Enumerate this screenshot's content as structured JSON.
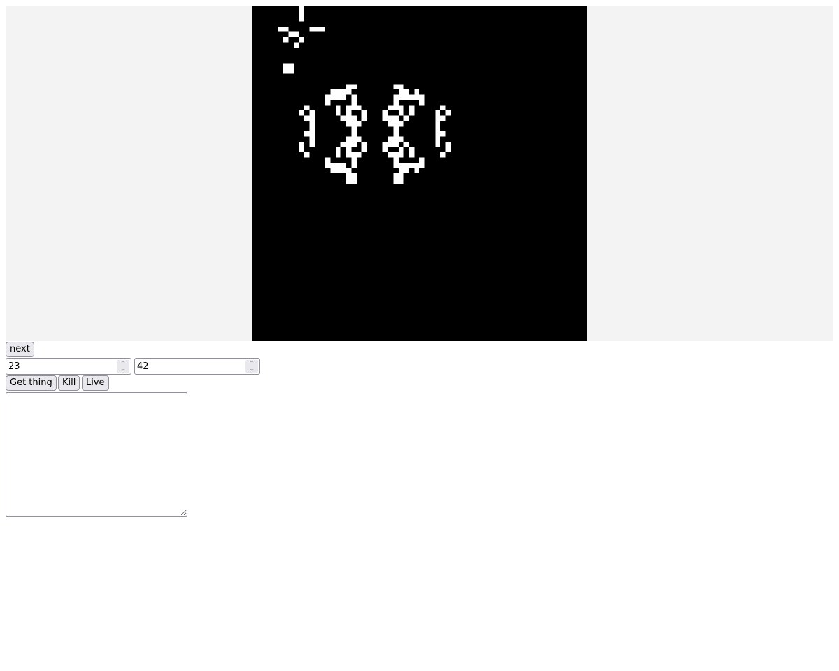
{
  "board": {
    "grid_columns": 64,
    "grid_rows": 64,
    "alive_color": "#ffffff",
    "dead_color": "#000000",
    "live_cells": [
      [
        9,
        0
      ],
      [
        9,
        1
      ],
      [
        9,
        2
      ],
      [
        5,
        4
      ],
      [
        6,
        4
      ],
      [
        11,
        4
      ],
      [
        12,
        4
      ],
      [
        13,
        4
      ],
      [
        7,
        5
      ],
      [
        8,
        5
      ],
      [
        6,
        6
      ],
      [
        9,
        6
      ],
      [
        8,
        7
      ],
      [
        6,
        11
      ],
      [
        7,
        11
      ],
      [
        6,
        12
      ],
      [
        7,
        12
      ],
      [
        18,
        15
      ],
      [
        19,
        15
      ],
      [
        27,
        15
      ],
      [
        28,
        15
      ],
      [
        15,
        16
      ],
      [
        16,
        16
      ],
      [
        17,
        16
      ],
      [
        18,
        16
      ],
      [
        28,
        16
      ],
      [
        29,
        16
      ],
      [
        31,
        16
      ],
      [
        14,
        17
      ],
      [
        15,
        17
      ],
      [
        16,
        17
      ],
      [
        17,
        17
      ],
      [
        19,
        17
      ],
      [
        27,
        17
      ],
      [
        28,
        17
      ],
      [
        29,
        17
      ],
      [
        30,
        17
      ],
      [
        31,
        17
      ],
      [
        32,
        17
      ],
      [
        14,
        18
      ],
      [
        19,
        18
      ],
      [
        27,
        18
      ],
      [
        32,
        18
      ],
      [
        10,
        19
      ],
      [
        16,
        19
      ],
      [
        18,
        19
      ],
      [
        19,
        19
      ],
      [
        20,
        19
      ],
      [
        26,
        19
      ],
      [
        27,
        19
      ],
      [
        28,
        19
      ],
      [
        30,
        19
      ],
      [
        36,
        19
      ],
      [
        9,
        20
      ],
      [
        11,
        20
      ],
      [
        16,
        20
      ],
      [
        18,
        20
      ],
      [
        21,
        20
      ],
      [
        25,
        20
      ],
      [
        28,
        20
      ],
      [
        30,
        20
      ],
      [
        35,
        20
      ],
      [
        37,
        20
      ],
      [
        10,
        21
      ],
      [
        11,
        21
      ],
      [
        17,
        21
      ],
      [
        18,
        21
      ],
      [
        19,
        21
      ],
      [
        21,
        21
      ],
      [
        25,
        21
      ],
      [
        26,
        21
      ],
      [
        27,
        21
      ],
      [
        29,
        21
      ],
      [
        35,
        21
      ],
      [
        36,
        21
      ],
      [
        11,
        22
      ],
      [
        18,
        22
      ],
      [
        19,
        22
      ],
      [
        20,
        22
      ],
      [
        26,
        22
      ],
      [
        27,
        22
      ],
      [
        28,
        22
      ],
      [
        35,
        22
      ],
      [
        11,
        23
      ],
      [
        19,
        23
      ],
      [
        27,
        23
      ],
      [
        35,
        23
      ],
      [
        10,
        24
      ],
      [
        11,
        24
      ],
      [
        19,
        24
      ],
      [
        27,
        24
      ],
      [
        35,
        24
      ],
      [
        36,
        24
      ],
      [
        11,
        25
      ],
      [
        18,
        25
      ],
      [
        19,
        25
      ],
      [
        20,
        25
      ],
      [
        26,
        25
      ],
      [
        27,
        25
      ],
      [
        28,
        25
      ],
      [
        35,
        25
      ],
      [
        9,
        26
      ],
      [
        11,
        26
      ],
      [
        17,
        26
      ],
      [
        18,
        26
      ],
      [
        19,
        26
      ],
      [
        21,
        26
      ],
      [
        25,
        26
      ],
      [
        26,
        26
      ],
      [
        27,
        26
      ],
      [
        29,
        26
      ],
      [
        35,
        26
      ],
      [
        37,
        26
      ],
      [
        9,
        27
      ],
      [
        16,
        27
      ],
      [
        18,
        27
      ],
      [
        21,
        27
      ],
      [
        25,
        27
      ],
      [
        28,
        27
      ],
      [
        30,
        27
      ],
      [
        37,
        27
      ],
      [
        10,
        28
      ],
      [
        16,
        28
      ],
      [
        18,
        28
      ],
      [
        19,
        28
      ],
      [
        20,
        28
      ],
      [
        26,
        28
      ],
      [
        27,
        28
      ],
      [
        28,
        28
      ],
      [
        30,
        28
      ],
      [
        36,
        28
      ],
      [
        14,
        29
      ],
      [
        19,
        29
      ],
      [
        27,
        29
      ],
      [
        32,
        29
      ],
      [
        14,
        30
      ],
      [
        15,
        30
      ],
      [
        16,
        30
      ],
      [
        17,
        30
      ],
      [
        19,
        30
      ],
      [
        27,
        30
      ],
      [
        28,
        30
      ],
      [
        29,
        30
      ],
      [
        30,
        30
      ],
      [
        31,
        30
      ],
      [
        32,
        30
      ],
      [
        15,
        31
      ],
      [
        16,
        31
      ],
      [
        17,
        31
      ],
      [
        18,
        31
      ],
      [
        28,
        31
      ],
      [
        29,
        31
      ],
      [
        31,
        31
      ],
      [
        18,
        32
      ],
      [
        19,
        32
      ],
      [
        27,
        32
      ],
      [
        28,
        32
      ],
      [
        18,
        33
      ],
      [
        19,
        33
      ],
      [
        27,
        33
      ],
      [
        28,
        33
      ]
    ]
  },
  "controls": {
    "next_label": "next",
    "row_value": "23",
    "col_value": "42",
    "get_thing_label": "Get thing",
    "kill_label": "Kill",
    "live_label": "Live",
    "output_text": ""
  },
  "icons": {
    "spinner_up": "spinner-up-icon",
    "spinner_down": "spinner-down-icon"
  }
}
